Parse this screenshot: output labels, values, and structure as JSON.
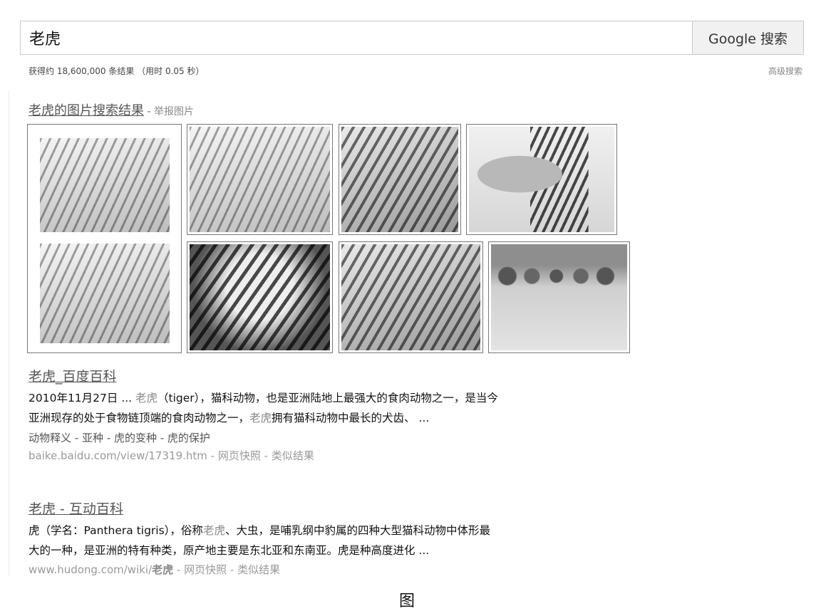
{
  "search": {
    "query": "老虎",
    "button_label": "Google 搜索"
  },
  "stats": "获得约 18,600,000 条结果 （用时 0.05 秒）",
  "advanced_search": "高级搜索",
  "image_results": {
    "title": "老虎的图片搜索结果",
    "separator": " - ",
    "report": "举报图片"
  },
  "results": [
    {
      "title": "老虎_百度百科",
      "snippet_line1_pre": "2010年11月27日 ... ",
      "snippet_line1_hl": "老虎",
      "snippet_line1_post": "（tiger），猫科动物，也是亚洲陆地上最强大的食肉动物之一，是当今",
      "snippet_line2_pre": "亚洲现存的处于食物链顶端的食肉动物之一，",
      "snippet_line2_hl": "老虎",
      "snippet_line2_post": "拥有猫科动物中最长的犬齿、 ...",
      "sitelinks": [
        "动物释义",
        "亚种",
        "虎的变种",
        "虎的保护"
      ],
      "url": "baike.baidu.com/view/17319.htm",
      "cache": "网页快照",
      "similar": "类似结果"
    },
    {
      "title": "老虎 - 互动百科",
      "snippet_line1_pre": "虎（学名：Panthera tigris），俗称",
      "snippet_line1_hl": "老虎",
      "snippet_line1_post": "、大虫，是哺乳纲中豹属的四种大型猫科动物中体形最",
      "snippet_line2": "大的一种，是亚洲的特有种类，原产地主要是东北亚和东南亚。虎是种高度进化 ...",
      "url_pre": "www.hudong.com/wiki/",
      "url_bold": "老虎",
      "cache": "网页快照",
      "similar": "类似结果"
    }
  ],
  "figure_label": "图"
}
